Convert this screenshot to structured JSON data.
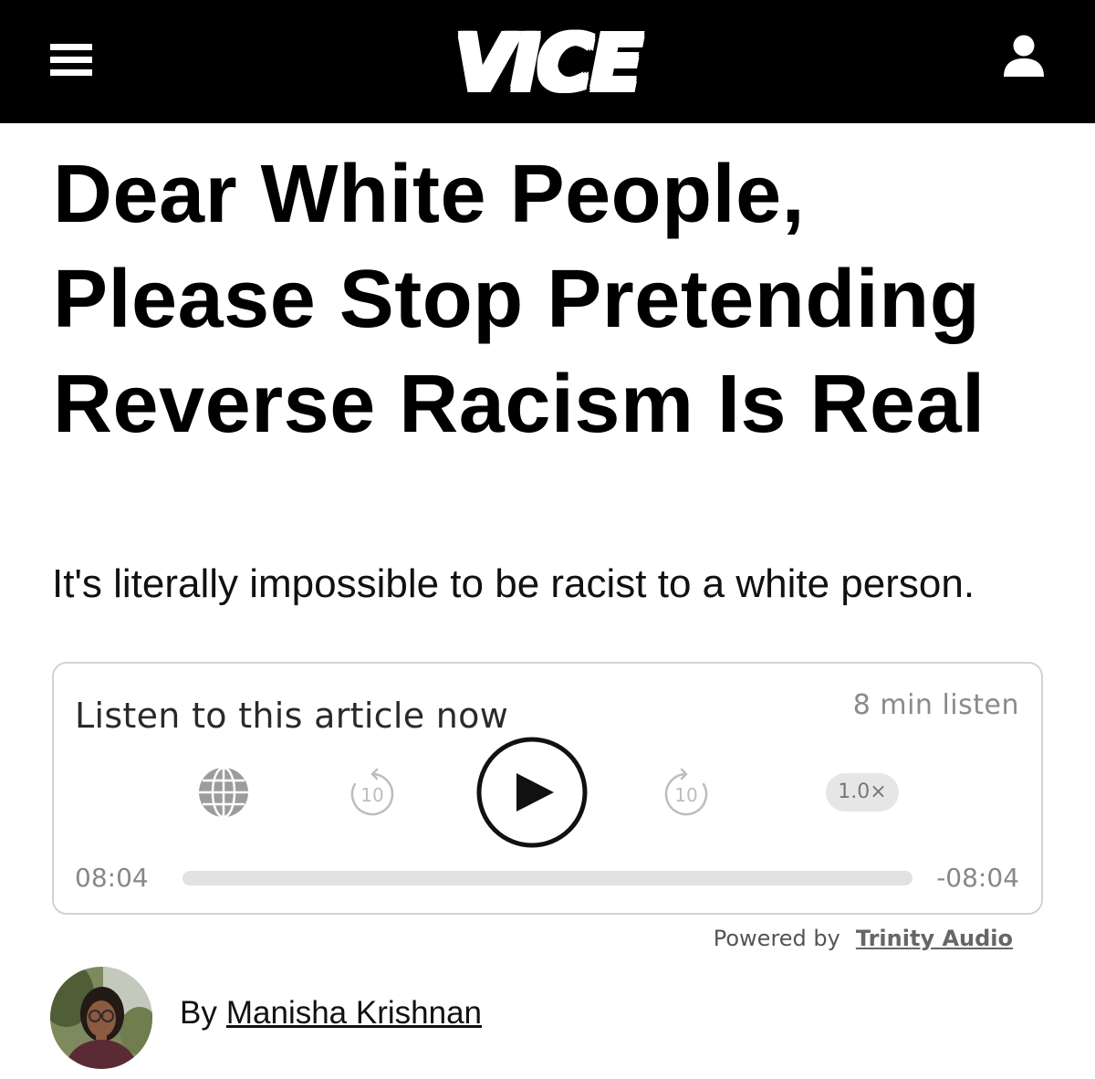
{
  "header": {
    "logo": "VICE",
    "background": "#000000",
    "menu_icon": "hamburger-menu-icon",
    "user_icon": "user-account-icon"
  },
  "article": {
    "headline_lines": [
      "Dear White People,",
      "Please Stop Pretending",
      "Reverse Racism Is Real"
    ],
    "subtitle": "It's literally impossible to be racist to a white person."
  },
  "player": {
    "title": "Listen to this article now",
    "duration_label": "8 min listen",
    "language_icon": "globe-icon",
    "rewind": {
      "icon": "rewind-10-icon",
      "seconds": "10"
    },
    "play_icon": "play-icon",
    "forward": {
      "icon": "forward-10-icon",
      "seconds": "10"
    },
    "speed": "1.0×",
    "elapsed": "08:04",
    "remaining": "-08:04",
    "progress": 0,
    "powered_by": "Powered by",
    "provider": "Trinity Audio"
  },
  "author": {
    "by": "By",
    "name": "Manisha Krishnan"
  },
  "colors": {
    "header_bg": "#000000",
    "text": "#000000",
    "muted": "#888888",
    "track": "#e2e2e2"
  }
}
